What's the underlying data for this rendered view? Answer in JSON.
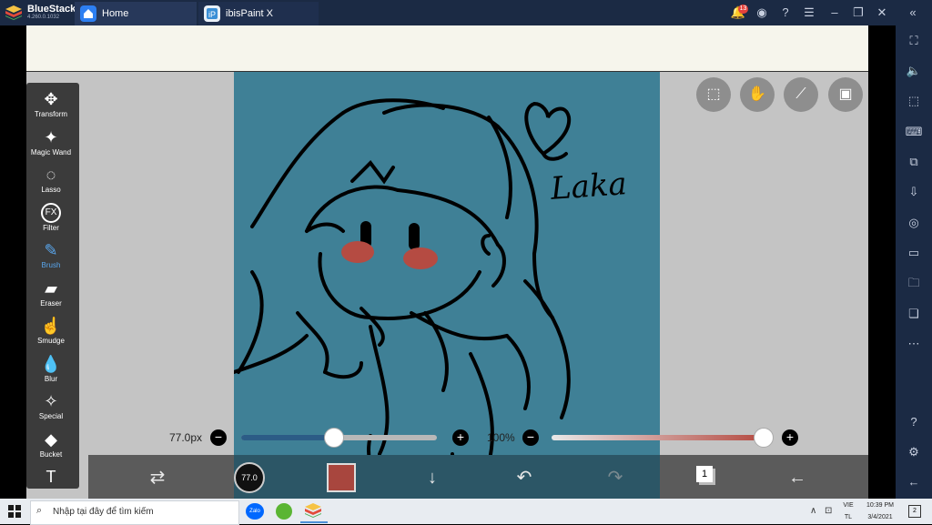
{
  "titlebar": {
    "app_name": "BlueStacks",
    "app_version": "4.260.0.1032",
    "tabs": [
      {
        "label": "Home"
      },
      {
        "label": "ibisPaint X"
      }
    ],
    "notification_count": "13"
  },
  "tools": [
    {
      "label": "Transform",
      "icon": "move-arrows-icon"
    },
    {
      "label": "Magic Wand",
      "icon": "magic-wand-icon"
    },
    {
      "label": "Lasso",
      "icon": "lasso-icon"
    },
    {
      "label": "Filter",
      "icon": "fx-icon",
      "glyph": "FX"
    },
    {
      "label": "Brush",
      "icon": "brush-icon",
      "active": true
    },
    {
      "label": "Eraser",
      "icon": "eraser-icon"
    },
    {
      "label": "Smudge",
      "icon": "smudge-icon"
    },
    {
      "label": "Blur",
      "icon": "blur-drop-icon"
    },
    {
      "label": "Special",
      "icon": "special-brush-icon"
    },
    {
      "label": "Bucket",
      "icon": "bucket-icon"
    },
    {
      "label": "",
      "icon": "text-tool-icon",
      "glyph": "T"
    }
  ],
  "brush": {
    "size_label": "77.0px",
    "size_fraction": 0.47,
    "opacity_label": "100%",
    "opacity_fraction": 1.0,
    "size_indicator": "77.0"
  },
  "colors": {
    "canvas": "#3f8096",
    "current_color": "#a8463e",
    "accent_active": "#5aa7ee"
  },
  "artwork_text": "Laka",
  "layers": {
    "count": "1"
  },
  "taskbar": {
    "search_placeholder": "Nhập tại đây để tìm kiếm",
    "lang_top": "VIE",
    "lang_bottom": "TL",
    "time": "10:39 PM",
    "date": "3/4/2021",
    "notifications": "2"
  }
}
